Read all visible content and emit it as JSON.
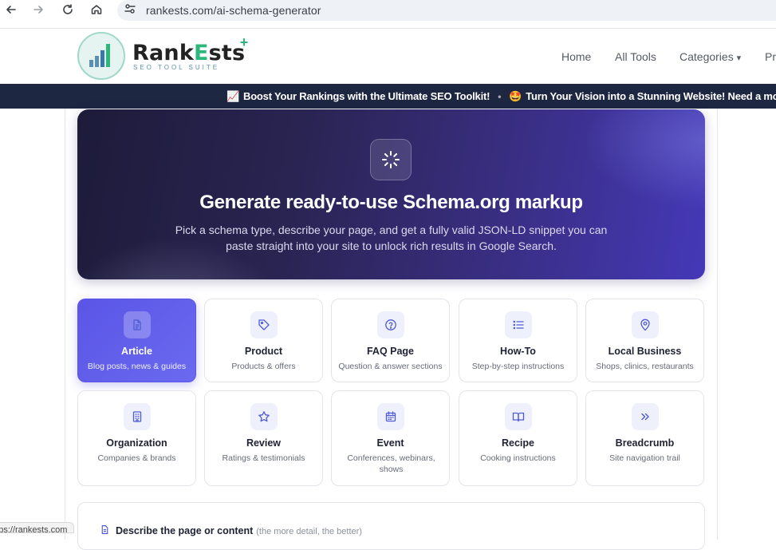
{
  "browser": {
    "url": "rankests.com/ai-schema-generator"
  },
  "header": {
    "logo_name_part1": "Rank",
    "logo_name_accent": "E",
    "logo_name_part2": "sts",
    "logo_sub": "SEO TOOL SUITE",
    "logo_plus": "+",
    "nav": {
      "home": "Home",
      "all_tools": "All Tools",
      "categories": "Categories",
      "categories_caret": "▾",
      "more": "Pr"
    }
  },
  "ticker": {
    "item1_emoji": "📈",
    "item1": "Boost Your Rankings with the Ultimate SEO Toolkit!",
    "separator": "•",
    "item2_emoji": "🤩",
    "item2": "Turn Your Vision into a Stunning Website! Need a modern"
  },
  "hero": {
    "title": "Generate ready-to-use Schema.org markup",
    "subtitle": "Pick a schema type, describe your page, and get a fully valid JSON-LD snippet you can paste straight into your site to unlock rich results in Google Search."
  },
  "schema_types": [
    {
      "title": "Article",
      "desc": "Blog posts, news & guides",
      "icon": "document-icon",
      "active": true
    },
    {
      "title": "Product",
      "desc": "Products & offers",
      "icon": "tag-icon"
    },
    {
      "title": "FAQ Page",
      "desc": "Question & answer sections",
      "icon": "question-circle-icon"
    },
    {
      "title": "How-To",
      "desc": "Step-by-step instructions",
      "icon": "list-icon"
    },
    {
      "title": "Local Business",
      "desc": "Shops, clinics, restaurants",
      "icon": "map-pin-icon"
    },
    {
      "title": "Organization",
      "desc": "Companies & brands",
      "icon": "building-icon"
    },
    {
      "title": "Review",
      "desc": "Ratings & testimonials",
      "icon": "star-icon"
    },
    {
      "title": "Event",
      "desc": "Conferences, webinars, shows",
      "icon": "calendar-icon"
    },
    {
      "title": "Recipe",
      "desc": "Cooking instructions",
      "icon": "book-open-icon"
    },
    {
      "title": "Breadcrumb",
      "desc": "Site navigation trail",
      "icon": "chevrons-right-icon"
    }
  ],
  "describe": {
    "label": "Describe the page or content",
    "hint": "(the more detail, the better)"
  },
  "status_bar": {
    "link": "https://rankests.com"
  },
  "colors": {
    "accent": "#5b55e6",
    "ticker_bg": "#1d2742",
    "icon": "#4f5bd5"
  }
}
